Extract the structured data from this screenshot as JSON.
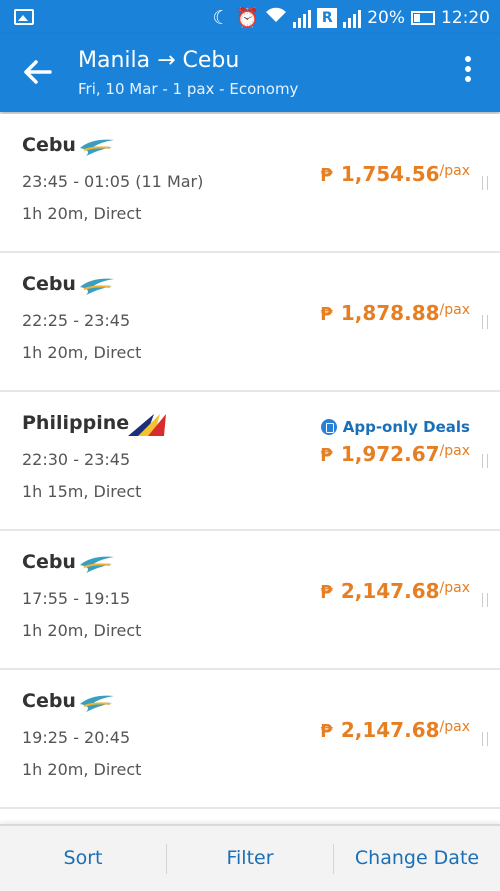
{
  "status": {
    "battery": "20%",
    "time": "12:20",
    "r_label": "R"
  },
  "header": {
    "title": "Manila → Cebu",
    "subtitle": "Fri, 10 Mar - 1 pax - Economy"
  },
  "flights": [
    {
      "airline": "Cebu",
      "logo": "cebu-logo",
      "times": "23:45 - 01:05 (11 Mar)",
      "duration": "1h 20m, Direct",
      "price_symbol": "₱",
      "price": "1,754.56",
      "unit": "/pax"
    },
    {
      "airline": "Cebu",
      "logo": "cebu-logo",
      "times": "22:25 - 23:45",
      "duration": "1h 20m, Direct",
      "price_symbol": "₱",
      "price": "1,878.88",
      "unit": "/pax"
    },
    {
      "airline": "Philippine",
      "logo": "pal-logo",
      "times": "22:30 - 23:45",
      "duration": "1h 15m, Direct",
      "deal": "App-only Deals",
      "price_symbol": "₱",
      "price": "1,972.67",
      "unit": "/pax"
    },
    {
      "airline": "Cebu",
      "logo": "cebu-logo",
      "times": "17:55 - 19:15",
      "duration": "1h 20m, Direct",
      "price_symbol": "₱",
      "price": "2,147.68",
      "unit": "/pax"
    },
    {
      "airline": "Cebu",
      "logo": "cebu-logo",
      "times": "19:25 - 20:45",
      "duration": "1h 20m, Direct",
      "price_symbol": "₱",
      "price": "2,147.68",
      "unit": "/pax"
    }
  ],
  "bottom": {
    "sort": "Sort",
    "filter": "Filter",
    "change_date": "Change Date"
  },
  "colors": {
    "primary": "#1a82d9",
    "price": "#e67e22",
    "link": "#1a6fb6"
  }
}
